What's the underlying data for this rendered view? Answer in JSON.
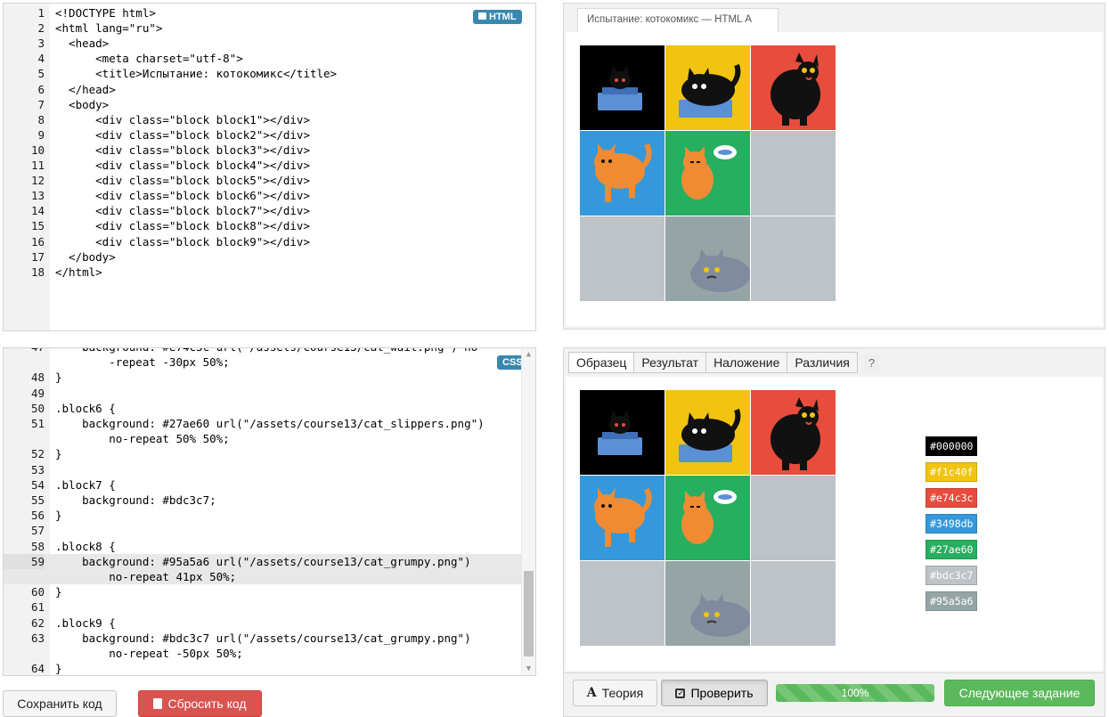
{
  "html_editor": {
    "badge": "HTML",
    "lines": [
      {
        "n": "1",
        "t": "<!DOCTYPE html>"
      },
      {
        "n": "2",
        "t": "<html lang=\"ru\">"
      },
      {
        "n": "3",
        "t": "  <head>"
      },
      {
        "n": "4",
        "t": "      <meta charset=\"utf-8\">"
      },
      {
        "n": "5",
        "t": "      <title>Испытание: котокомикс</title>"
      },
      {
        "n": "6",
        "t": "  </head>"
      },
      {
        "n": "7",
        "t": "  <body>"
      },
      {
        "n": "8",
        "t": "      <div class=\"block block1\"></div>"
      },
      {
        "n": "9",
        "t": "      <div class=\"block block2\"></div>"
      },
      {
        "n": "10",
        "t": "      <div class=\"block block3\"></div>"
      },
      {
        "n": "11",
        "t": "      <div class=\"block block4\"></div>"
      },
      {
        "n": "12",
        "t": "      <div class=\"block block5\"></div>"
      },
      {
        "n": "13",
        "t": "      <div class=\"block block6\"></div>"
      },
      {
        "n": "14",
        "t": "      <div class=\"block block7\"></div>"
      },
      {
        "n": "15",
        "t": "      <div class=\"block block8\"></div>"
      },
      {
        "n": "16",
        "t": "      <div class=\"block block9\"></div>"
      },
      {
        "n": "17",
        "t": "  </body>"
      },
      {
        "n": "18",
        "t": "</html>"
      }
    ]
  },
  "css_editor": {
    "badge": "CSS",
    "lines": [
      {
        "n": "47",
        "t": "    background: #e74c3c url(\"/assets/course13/cat_wait.png\") no",
        "partial": true
      },
      {
        "n": "",
        "t": "        -repeat -30px 50%;"
      },
      {
        "n": "48",
        "t": "}"
      },
      {
        "n": "49",
        "t": ""
      },
      {
        "n": "50",
        "t": ".block6 {"
      },
      {
        "n": "51",
        "t": "    background: #27ae60 url(\"/assets/course13/cat_slippers.png\")"
      },
      {
        "n": "",
        "t": "        no-repeat 50% 50%;"
      },
      {
        "n": "52",
        "t": "}"
      },
      {
        "n": "53",
        "t": ""
      },
      {
        "n": "54",
        "t": ".block7 {"
      },
      {
        "n": "55",
        "t": "    background: #bdc3c7;"
      },
      {
        "n": "56",
        "t": "}"
      },
      {
        "n": "57",
        "t": ""
      },
      {
        "n": "58",
        "t": ".block8 {"
      },
      {
        "n": "59",
        "t": "    background: #95a5a6 url(\"/assets/course13/cat_grumpy.png\")",
        "active": true
      },
      {
        "n": "",
        "t": "        no-repeat 41px 50%;",
        "active": true
      },
      {
        "n": "60",
        "t": "}"
      },
      {
        "n": "61",
        "t": ""
      },
      {
        "n": "62",
        "t": ".block9 {"
      },
      {
        "n": "63",
        "t": "    background: #bdc3c7 url(\"/assets/course13/cat_grumpy.png\")"
      },
      {
        "n": "",
        "t": "        no-repeat -50px 50%;"
      },
      {
        "n": "64",
        "t": "}"
      }
    ]
  },
  "preview": {
    "tab_title": "Испытание: котокомикс — HTML А"
  },
  "blocks": [
    {
      "color": "#000000",
      "cat": "box-small"
    },
    {
      "color": "#f1c40f",
      "cat": "box-big"
    },
    {
      "color": "#e74c3c",
      "cat": "black-wait"
    },
    {
      "color": "#3498db",
      "cat": "orange-walk"
    },
    {
      "color": "#27ae60",
      "cat": "orange-slippers"
    },
    {
      "color": "#bdc3c7",
      "cat": ""
    },
    {
      "color": "#bdc3c7",
      "cat": ""
    },
    {
      "color": "#95a5a6",
      "cat": "grumpy"
    },
    {
      "color": "#bdc3c7",
      "cat": ""
    }
  ],
  "compare": {
    "tabs": [
      "Образец",
      "Результат",
      "Наложение",
      "Различия"
    ],
    "help": "?",
    "swatches": [
      {
        "label": "#000000",
        "color": "#000000"
      },
      {
        "label": "#f1c40f",
        "color": "#f1c40f"
      },
      {
        "label": "#e74c3c",
        "color": "#e74c3c"
      },
      {
        "label": "#3498db",
        "color": "#3498db"
      },
      {
        "label": "#27ae60",
        "color": "#27ae60"
      },
      {
        "label": "#bdc3c7",
        "color": "#bdc3c7"
      },
      {
        "label": "#95a5a6",
        "color": "#95a5a6"
      }
    ]
  },
  "actions": {
    "save": "Сохранить код",
    "reset": "Сбросить код",
    "theory": "Теория",
    "check": "Проверить",
    "progress": "100%",
    "progress_value": 1.0,
    "next": "Следующее задание"
  }
}
